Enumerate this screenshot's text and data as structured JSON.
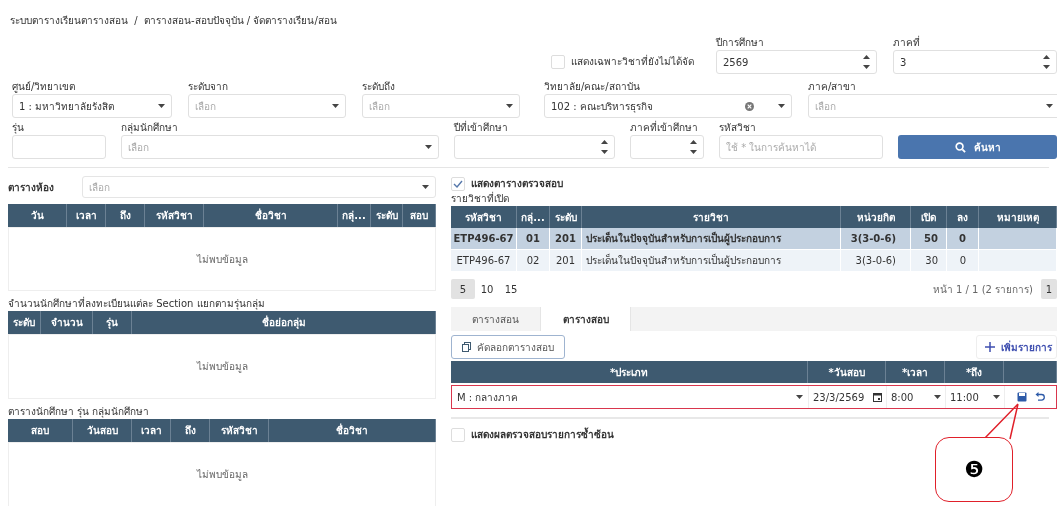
{
  "breadcrumb": "ระบบตารางเรียนตารางสอน  /  ตารางสอน-สอบปัจจุบัน / จัดตารางเรียน/สอน",
  "top_row": {
    "checkbox": {
      "label": "แสดงเฉพาะวิชาที่ยังไม่ได้จัด",
      "checked": false
    },
    "fields": [
      {
        "kind": "spinner",
        "label": "ปีการศึกษา",
        "value": "2569"
      },
      {
        "kind": "spinner",
        "label": "ภาคที่",
        "value": "3"
      }
    ]
  },
  "filter_row_1": [
    {
      "kind": "select",
      "label": "ศูนย์/วิทยาเขต",
      "value": "1 : มหาวิทยาลัยรังสิต"
    },
    {
      "kind": "select",
      "label": "ระดับจาก",
      "placeholder": "เลือก"
    },
    {
      "kind": "select",
      "label": "ระดับถึง",
      "placeholder": "เลือก"
    },
    {
      "kind": "select",
      "label": "วิทยาลัย/คณะ/สถาบัน",
      "value": "102 : คณะบริหารธุรกิจ",
      "clearable": true
    },
    {
      "kind": "select",
      "label": "ภาค/สาขา",
      "placeholder": "เลือก"
    }
  ],
  "filter_row_2": [
    {
      "kind": "input",
      "label": "รุ่น"
    },
    {
      "kind": "select",
      "label": "กลุ่มนักศึกษา",
      "placeholder": "เลือก"
    },
    {
      "kind": "spinner",
      "label": "ปีที่เข้าศึกษา"
    },
    {
      "kind": "spinner",
      "label": "ภาคที่เข้าศึกษา"
    },
    {
      "kind": "input",
      "label": "รหัสวิชา",
      "placeholder": "ใช้ * ในการค้นหาได้"
    }
  ],
  "search_button": "ค้นหา",
  "room_schedule": {
    "label": "ตารางห้อง",
    "placeholder": "เลือก",
    "columns": [
      "วัน",
      "เวลา",
      "ถึง",
      "รหัสวิชา",
      "ชื่อวิชา",
      "กลุ่...",
      "ระดับ",
      "สอบ"
    ],
    "empty_text": "ไม่พบข้อมูล"
  },
  "section_counts": {
    "title": "จำนวนนักศึกษาที่ลงทะเบียนแต่ละ Section แยกตามรุ่นกลุ่ม",
    "columns": [
      "ระดับ",
      "จำนวน",
      "รุ่น",
      "ชื่อย่อกลุ่ม"
    ],
    "empty_text": "ไม่พบข้อมูล"
  },
  "student_schedule": {
    "title": "ตารางนักศึกษา รุ่น กลุ่มนักศึกษา",
    "columns": [
      "สอบ",
      "วันสอบ",
      "เวลา",
      "ถึง",
      "รหัสวิชา",
      "ชื่อวิชา"
    ],
    "empty_text": "ไม่พบข้อมูล"
  },
  "show_check_table": {
    "label": "แสดงตารางตรวจสอบ",
    "checked": true
  },
  "open_courses": {
    "title": "รายวิชาที่เปิด",
    "columns": [
      "รหัสวิชา",
      "กลุ่...",
      "ระดับ",
      "รายวิชา",
      "หน่วยกิต",
      "เปิด",
      "ลง",
      "หมายเหตุ"
    ],
    "rows": [
      {
        "selected": true,
        "cells": [
          "ETP496-67",
          "01",
          "201",
          "ประเด็นในปัจจุบันสำหรับการเป็นผู้ประกอบการ",
          "3(3-0-6)",
          "50",
          "0"
        ]
      },
      {
        "selected": false,
        "cells": [
          "ETP496-67",
          "02",
          "201",
          "ประเด็นในปัจจุบันสำหรับการเป็นผู้ประกอบการ",
          "3(3-0-6)",
          "30",
          "0"
        ]
      }
    ]
  },
  "pagination": {
    "page_sizes": [
      {
        "label": "5",
        "selected": true
      },
      {
        "label": "10",
        "selected": false
      },
      {
        "label": "15",
        "selected": false
      }
    ],
    "summary": "หน้า 1 / 1 (2 รายการ)",
    "pages": [
      {
        "label": "1",
        "selected": true
      }
    ]
  },
  "tabs": [
    {
      "label": "ตารางสอน",
      "selected": false
    },
    {
      "label": "ตารางสอบ",
      "selected": true
    }
  ],
  "copy_button": "คัดลอกตารางสอบ",
  "add_button": "เพิ่มรายการ",
  "exam_table": {
    "columns": [
      "*ประเภท",
      "*วันสอบ",
      "*เวลา",
      "*ถึง"
    ],
    "rows": [
      {
        "editing": true,
        "type": "M : กลางภาค",
        "date": "23/3/2569",
        "start": "8:00",
        "end": "11:00"
      }
    ]
  },
  "duplicate_check": {
    "label": "แสดงผลตรวจสอบรายการซ้ำซ้อน",
    "checked": false
  },
  "callout": {
    "text": "❺"
  }
}
